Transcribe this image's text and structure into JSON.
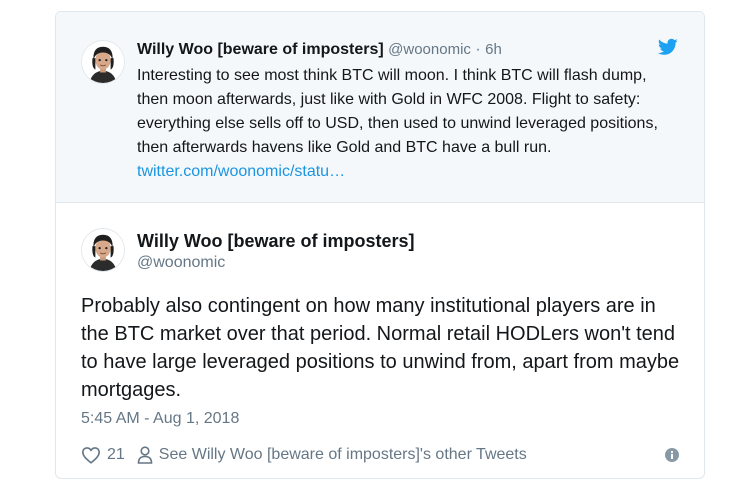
{
  "parent_tweet": {
    "author_name": "Willy Woo [beware of imposters]",
    "handle": "@woonomic",
    "separator": "·",
    "time": "6h",
    "text": "Interesting to see most think BTC will moon. I think BTC will flash dump, then moon afterwards, just like with Gold in WFC 2008. Flight to safety: everything else sells off to USD, then used to unwind leveraged positions, then afterwards havens like Gold and BTC have a bull run.",
    "link": "twitter.com/woonomic/statu…",
    "icon": "twitter-bird-icon"
  },
  "main_tweet": {
    "author_name": "Willy Woo [beware of imposters]",
    "handle": "@woonomic",
    "text": "Probably also contingent on how many institutional players are in the BTC market over that period. Normal retail HODLers won't tend to have large leveraged positions to unwind from, apart from maybe mortgages.",
    "timestamp": "5:45 AM - Aug 1, 2018",
    "likes": "21",
    "other_tweets_label": "See Willy Woo [beware of imposters]'s other Tweets"
  },
  "colors": {
    "link": "#1b95e0",
    "muted": "#657786",
    "border": "#e1e8ed",
    "parent_bg": "#f5f8fa"
  }
}
